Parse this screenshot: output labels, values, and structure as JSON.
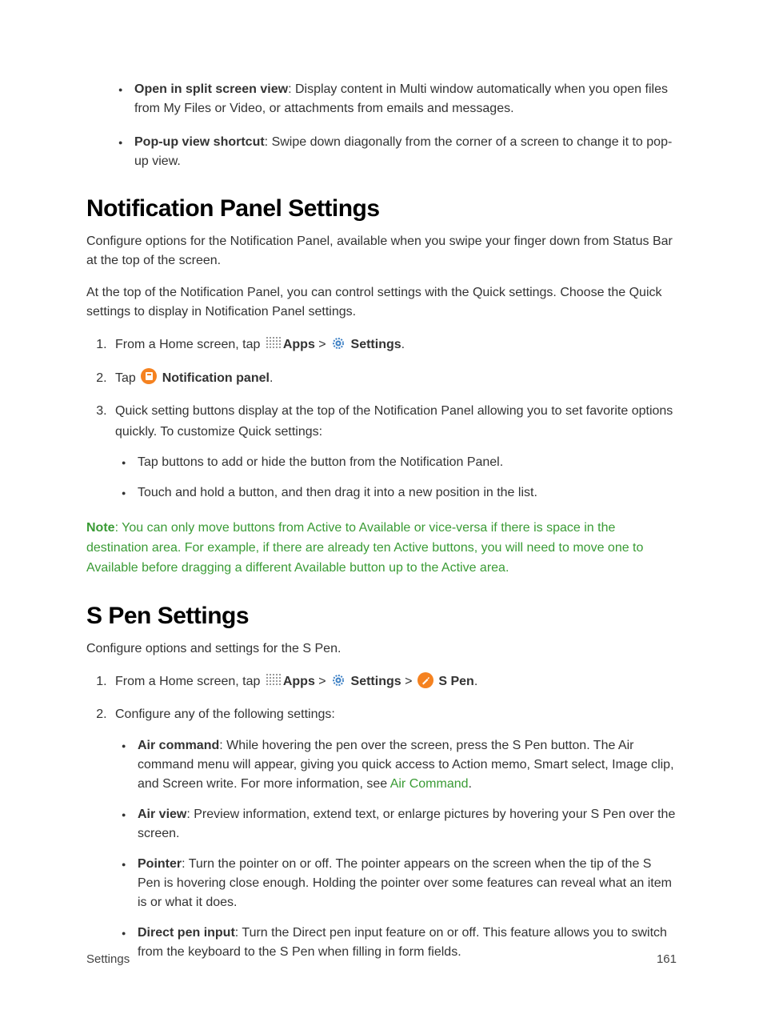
{
  "topBullets": [
    {
      "bold": "Open in split screen view",
      "text": ": Display content in Multi window automatically when you open files from My Files or Video, or attachments from emails and messages."
    },
    {
      "bold": "Pop-up view shortcut",
      "text": ": Swipe down diagonally from the corner of a screen to change it to pop-up view."
    }
  ],
  "section1": {
    "heading": "Notification Panel Settings",
    "para1": "Configure options for the Notification Panel, available when you swipe your finger down from Status Bar at the top of the screen.",
    "para2": "At the top of the Notification Panel, you can control settings with the Quick settings. Choose the Quick settings to display in Notification Panel settings.",
    "step1_prefix": "From a Home screen, tap ",
    "step1_apps": "Apps",
    "step1_sep": " > ",
    "step1_settings": "Settings",
    "step1_end": ".",
    "step2_prefix": "Tap ",
    "step2_label": "Notification panel",
    "step2_end": ".",
    "step3": "Quick setting buttons display at the top of the Notification Panel allowing you to set favorite options quickly. To customize Quick settings:",
    "step3_bullets": [
      "Tap buttons to add or hide the button from the Notification Panel.",
      "Touch and hold a button, and then drag it into a new position in the list."
    ],
    "note_label": "Note",
    "note_text": ": You can only move buttons from Active to Available or vice-versa if there is space in the destination area. For example, if there are already ten Active buttons, you will need to move one to Available before dragging a different Available button up to the Active area."
  },
  "section2": {
    "heading": "S Pen Settings",
    "para1": "Configure options and settings for the S Pen.",
    "step1_prefix": "From a Home screen, tap ",
    "step1_apps": "Apps",
    "step1_sep": " > ",
    "step1_settings": "Settings",
    "step1_sep2": " > ",
    "step1_spen": "S Pen",
    "step1_end": ".",
    "step2": "Configure any of the following settings:",
    "bullets": [
      {
        "bold": "Air command",
        "text": ": While hovering the pen over the screen, press the S Pen button. The Air command menu will appear, giving you quick access to Action memo, Smart select, Image clip, and Screen write. For more information, see ",
        "link": "Air Command",
        "after": "."
      },
      {
        "bold": "Air view",
        "text": ": Preview information, extend text, or enlarge pictures by hovering your S Pen over the screen."
      },
      {
        "bold": "Pointer",
        "text": ": Turn the pointer on or off. The pointer appears on the screen when the tip of the S Pen is hovering close enough. Holding the pointer over some features can reveal what an item is or what it does."
      },
      {
        "bold": "Direct pen input",
        "text": ": Turn the Direct pen input feature on or off. This feature allows you to switch from the keyboard to the S Pen when filling in form fields."
      }
    ]
  },
  "footer": {
    "left": "Settings",
    "right": "161"
  }
}
